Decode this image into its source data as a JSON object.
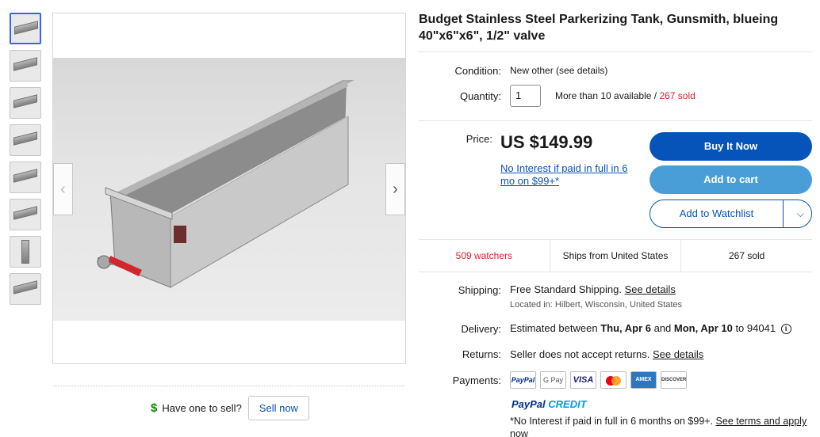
{
  "thumbnails": [
    {
      "label": "product-photo-1"
    },
    {
      "label": "product-photo-2"
    },
    {
      "label": "product-photo-3"
    },
    {
      "label": "product-photo-4"
    },
    {
      "label": "product-photo-5"
    },
    {
      "label": "product-photo-6"
    },
    {
      "label": "product-photo-7"
    },
    {
      "label": "product-photo-8"
    }
  ],
  "gallery": {
    "prev_icon": "‹",
    "next_icon": "›"
  },
  "sell": {
    "prompt": "Have one to sell?",
    "button": "Sell now",
    "icon": "$"
  },
  "listing": {
    "title": "Budget Stainless Steel Parkerizing Tank, Gunsmith, blueing 40\"x6\"x6\", 1/2\" valve",
    "condition_label": "Condition:",
    "condition_value": "New other (see details)",
    "quantity_label": "Quantity:",
    "quantity_value": "1",
    "availability": "More than 10 available",
    "availability_sep": " / ",
    "sold": "267 sold",
    "price_label": "Price:",
    "price": "US $149.99",
    "no_interest": "No Interest if paid in full in 6 mo on $99+*"
  },
  "actions": {
    "buy": "Buy It Now",
    "cart": "Add to cart",
    "watch": "Add to Watchlist",
    "watch_chevron": "⌵"
  },
  "stats": {
    "watchers": "509 watchers",
    "ships": "Ships from United States",
    "sold": "267 sold"
  },
  "shipping": {
    "label": "Shipping:",
    "value": "Free Standard Shipping.",
    "details": "See details",
    "location": "Located in: Hilbert, Wisconsin, United States"
  },
  "delivery": {
    "label": "Delivery:",
    "prefix": "Estimated between ",
    "start": "Thu, Apr 6",
    "middle": " and ",
    "end": "Mon, Apr 10",
    "suffix": " to 94041",
    "info_icon": "i"
  },
  "returns": {
    "label": "Returns:",
    "value": "Seller does not accept returns.",
    "details": "See details"
  },
  "payments": {
    "label": "Payments:",
    "methods": [
      "PayPal",
      "G Pay",
      "VISA",
      "Mastercard",
      "AMEX",
      "DISCOVER"
    ],
    "credit_1": "PayPal",
    "credit_2": "CREDIT",
    "fine_print": "*No Interest if paid in full in 6 months on $99+.",
    "fine_link": "See terms and apply now"
  },
  "colors": {
    "primary_blue": "#0654ba",
    "secondary_blue": "#4a9ed8",
    "sold_red": "#dd1e31",
    "selected_thumb": "#3665f3"
  }
}
